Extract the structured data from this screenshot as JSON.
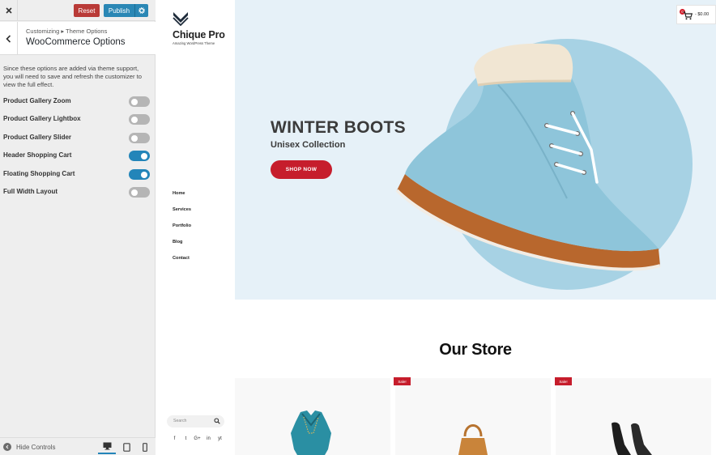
{
  "customizer": {
    "reset_label": "Reset",
    "publish_label": "Publish",
    "breadcrumb": "Customizing ▸ Theme Options",
    "section_title": "WooCommerce Options",
    "description": "Since these options are added via theme support, you will need to save and refresh the customizer to view the full effect.",
    "options": [
      {
        "label": "Product Gallery Zoom",
        "enabled": false
      },
      {
        "label": "Product Gallery Lightbox",
        "enabled": false
      },
      {
        "label": "Product Gallery Slider",
        "enabled": false
      },
      {
        "label": "Header Shopping Cart",
        "enabled": true
      },
      {
        "label": "Floating Shopping Cart",
        "enabled": true
      },
      {
        "label": "Full Width Layout",
        "enabled": false
      }
    ],
    "footer": {
      "hide_controls": "Hide Controls",
      "device_active": "desktop"
    }
  },
  "site": {
    "brand": "Chique Pro",
    "tagline": "Amazing WordPress Theme",
    "nav": [
      "Home",
      "Services",
      "Portfolio",
      "Blog",
      "Contact"
    ],
    "search_placeholder": "Search",
    "socials": [
      "f",
      "t",
      "G+",
      "in",
      "yt"
    ],
    "hero": {
      "title": "WINTER BOOTS",
      "subtitle": "Unisex Collection",
      "button": "SHOP NOW"
    },
    "cart": {
      "count": "0",
      "price": "- $0.00"
    },
    "store_title": "Our Store",
    "sale_badge": "Sale!",
    "colors": {
      "accent": "#c61d2c",
      "wp_blue": "#2385b9",
      "hero_bg": "#e6f1f8",
      "circle": "#a7d2e4"
    }
  }
}
